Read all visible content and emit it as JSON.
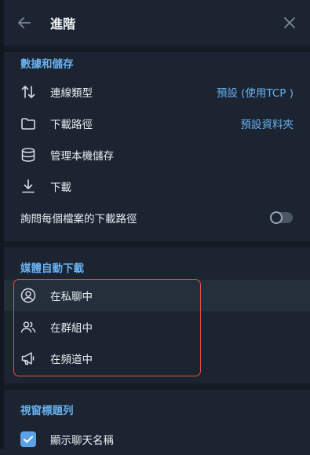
{
  "header": {
    "title": "進階",
    "back_icon": "arrow-left-icon",
    "close_icon": "close-icon"
  },
  "data_storage": {
    "section_title": "數據和儲存",
    "connection_type": {
      "label": "連線類型",
      "value": "預設 (使用TCP )",
      "icon": "arrows-updown-icon"
    },
    "download_path": {
      "label": "下載路徑",
      "value": "預設資料夾",
      "icon": "folder-icon"
    },
    "manage_storage": {
      "label": "管理本機儲存",
      "icon": "database-icon"
    },
    "downloads": {
      "label": "下載",
      "icon": "download-icon"
    },
    "ask_path": {
      "label": "詢問每個檔案的下載路徑",
      "enabled": false
    }
  },
  "auto_download": {
    "section_title": "媒體自動下載",
    "items": [
      {
        "label": "在私聊中",
        "icon": "user-circle-icon"
      },
      {
        "label": "在群組中",
        "icon": "users-icon"
      },
      {
        "label": "在頻道中",
        "icon": "megaphone-icon"
      }
    ]
  },
  "window_title_bar": {
    "section_title": "視窗標題列",
    "show_chat_name": {
      "label": "顯示聊天名稱",
      "checked": true
    }
  },
  "colors": {
    "accent": "#6ab0ef",
    "highlight_border": "#e0533f",
    "background": "#1b2430"
  }
}
